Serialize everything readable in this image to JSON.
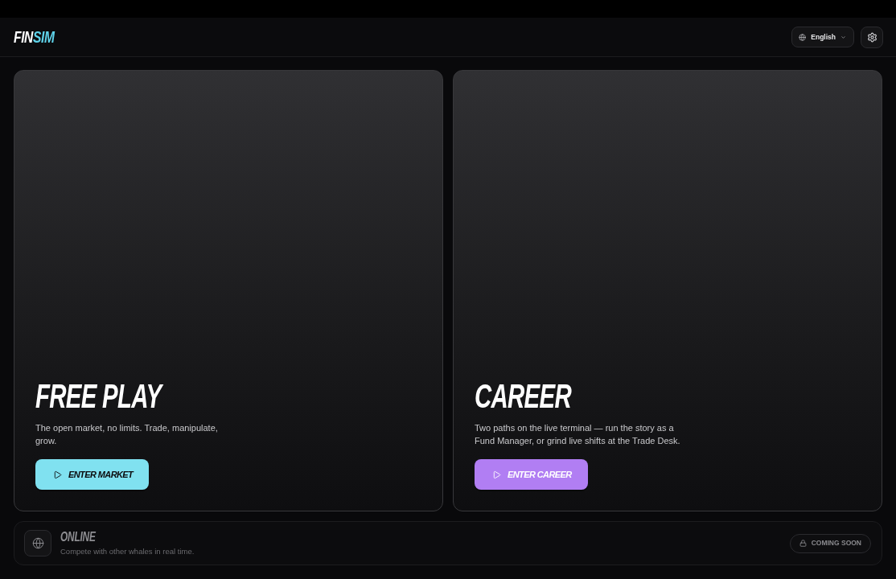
{
  "header": {
    "logo": [
      "FIN",
      "SIM"
    ],
    "language": "English"
  },
  "modes": [
    {
      "title": "FREE PLAY",
      "description": "The open market, no limits. Trade, manipulate, grow.",
      "button": "ENTER MARKET",
      "color": "#80e1f0"
    },
    {
      "title": "CAREER",
      "description": "Two paths on the live terminal — run the story as a Fund Manager, or grind live shifts at the Trade Desk.",
      "button": "ENTER CAREER",
      "color": "#b17ef3"
    }
  ],
  "online": {
    "title": "ONLINE",
    "description": "Compete with other whales in real time.",
    "badge": "COMING SOON",
    "disabled": true
  }
}
